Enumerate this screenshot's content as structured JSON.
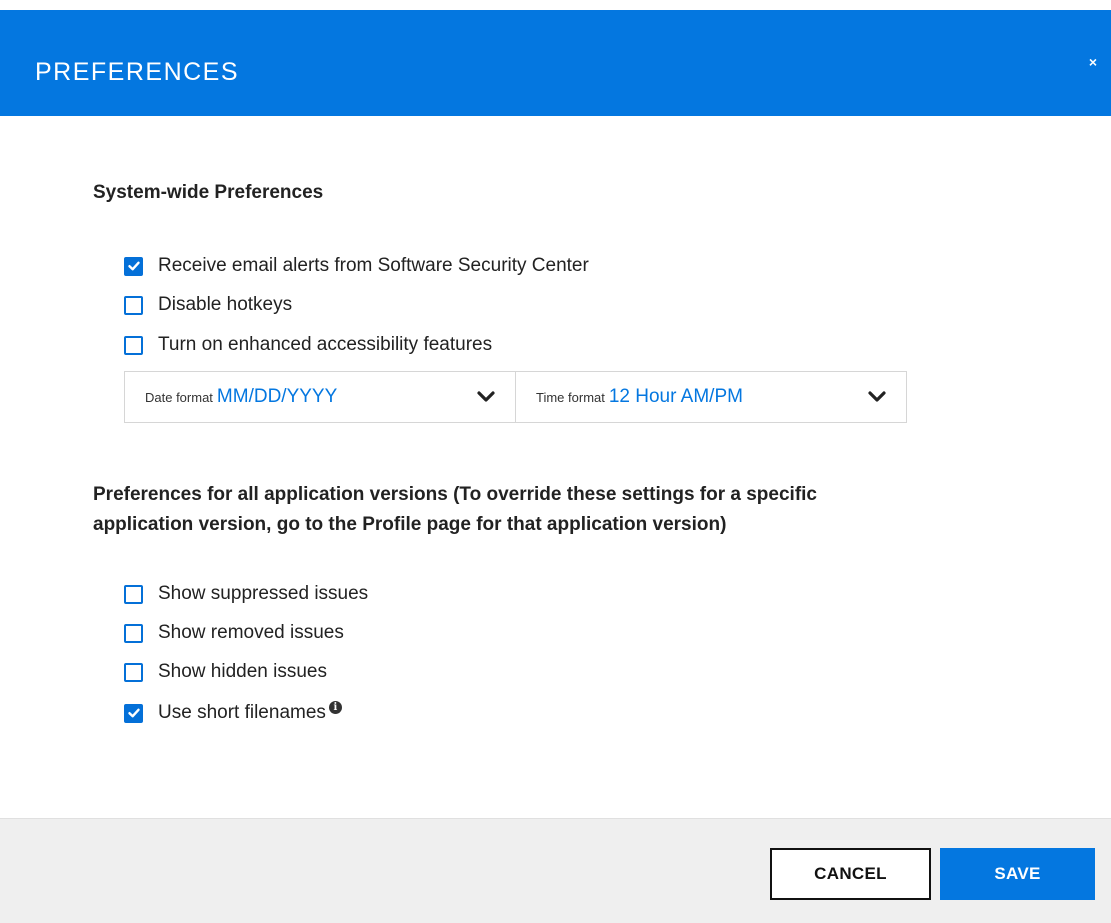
{
  "dialog": {
    "title": "PREFERENCES",
    "close_label": "×"
  },
  "system_section": {
    "heading": "System-wide Preferences",
    "options": [
      {
        "label": "Receive email alerts from Software Security Center",
        "checked": true
      },
      {
        "label": "Disable hotkeys",
        "checked": false
      },
      {
        "label": "Turn on enhanced accessibility features",
        "checked": false
      }
    ],
    "date_format": {
      "label": "Date format",
      "value": "MM/DD/YYYY"
    },
    "time_format": {
      "label": "Time format",
      "value": "12 Hour AM/PM"
    }
  },
  "app_section": {
    "heading_line1": "Preferences for all application versions (To override these settings for a specific",
    "heading_line2": "application version, go to the Profile page for that application version)",
    "options": [
      {
        "label": "Show suppressed issues",
        "checked": false
      },
      {
        "label": "Show removed issues",
        "checked": false
      },
      {
        "label": "Show hidden issues",
        "checked": false
      },
      {
        "label": "Use short filenames",
        "checked": true,
        "info_icon": "i"
      }
    ]
  },
  "footer": {
    "cancel_label": "CANCEL",
    "save_label": "SAVE"
  },
  "colors": {
    "accent": "#0477e0",
    "checkbox": "#0470d8",
    "footer_bg": "#efefef"
  }
}
